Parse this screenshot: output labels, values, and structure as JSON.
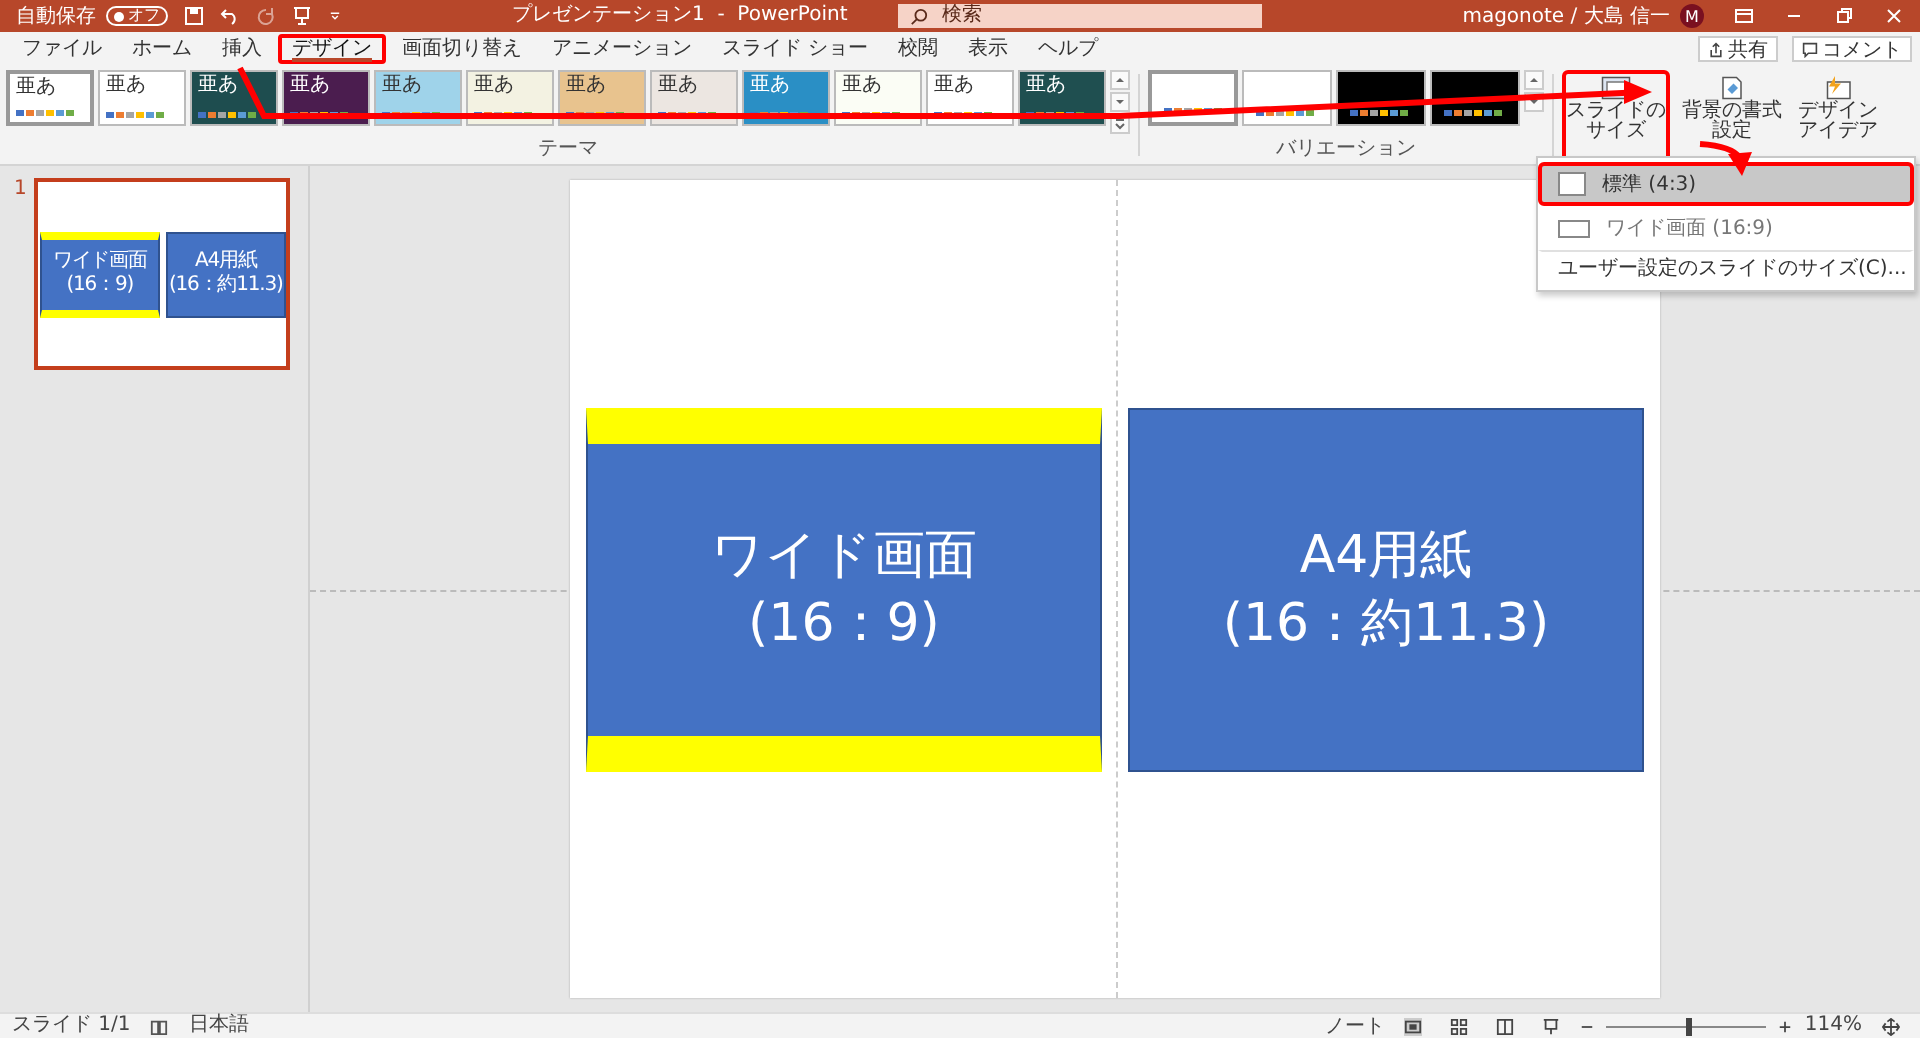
{
  "title_bar": {
    "autosave_label": "自動保存",
    "autosave_toggle": {
      "label": "オフ",
      "on": false
    },
    "title": "プレゼンテーション1  -  PowerPoint",
    "search": {
      "placeholder": "検索"
    },
    "user": "magonote / 大島 信一",
    "avatar": "M"
  },
  "tabs": [
    {
      "label": "ファイル",
      "selected": false,
      "highlighted": false
    },
    {
      "label": "ホーム",
      "selected": false,
      "highlighted": false
    },
    {
      "label": "挿入",
      "selected": false,
      "highlighted": false
    },
    {
      "label": "デザイン",
      "selected": true,
      "highlighted": true
    },
    {
      "label": "画面切り替え",
      "selected": false,
      "highlighted": false
    },
    {
      "label": "アニメーション",
      "selected": false,
      "highlighted": false
    },
    {
      "label": "スライド ショー",
      "selected": false,
      "highlighted": false
    },
    {
      "label": "校閲",
      "selected": false,
      "highlighted": false
    },
    {
      "label": "表示",
      "selected": false,
      "highlighted": false
    },
    {
      "label": "ヘルプ",
      "selected": false,
      "highlighted": false
    }
  ],
  "share_button": "共有",
  "comment_button": "コメント",
  "themes": {
    "label": "テーマ",
    "items": [
      {
        "label": "亜あ",
        "color": "#ffffff",
        "selected": true
      },
      {
        "label": "亜あ",
        "color": "#ffffff",
        "selected": false
      },
      {
        "label": "亜あ",
        "color": "#1e4d4f",
        "selected": false
      },
      {
        "label": "亜あ",
        "color": "#4b1d4f",
        "selected": false
      },
      {
        "label": "亜あ",
        "color": "#9fd3ea",
        "selected": false
      },
      {
        "label": "亜あ",
        "color": "#f3f2e2",
        "selected": false
      },
      {
        "label": "亜あ",
        "color": "#e8c38e",
        "selected": false
      },
      {
        "label": "亜あ",
        "color": "#ece6e1",
        "selected": false
      },
      {
        "label": "亜あ",
        "color": "#2a8fc5",
        "selected": false
      },
      {
        "label": "亜あ",
        "color": "#fbfdf5",
        "selected": false
      },
      {
        "label": "亜あ",
        "color": "#ffffff",
        "selected": false
      },
      {
        "label": "亜あ",
        "color": "#1f4f50",
        "selected": false
      }
    ]
  },
  "variations": {
    "label": "バリエーション",
    "items": [
      {
        "color": "#ffffff",
        "selected": true
      },
      {
        "color": "#ffffff",
        "selected": false
      },
      {
        "color": "#000000",
        "selected": false
      },
      {
        "color": "#000000",
        "selected": false
      }
    ]
  },
  "slide_size_button": {
    "label": "スライドのサイズ",
    "highlighted": true
  },
  "format_background_button": "背景の書式設定",
  "design_ideas_button": "デザインアイデア",
  "slide_size_menu": [
    {
      "label": "標準 (4:3)",
      "selected": true,
      "highlighted": true
    },
    {
      "label": "ワイド画面 (16:9)",
      "selected": false,
      "highlighted": false
    },
    {
      "label": "ユーザー設定のスライドのサイズ(C)...",
      "selected": false,
      "highlighted": false,
      "kind": "command"
    }
  ],
  "thumbnail": {
    "number": "1",
    "selected": true,
    "shapes": [
      {
        "kind": "banded",
        "lines": [
          "ワイド画面",
          "(16：9)"
        ]
      },
      {
        "kind": "plain",
        "lines": [
          "A4用紙",
          "(16：約11.3)"
        ]
      }
    ]
  },
  "slide": {
    "shapes": [
      {
        "kind": "banded",
        "lines": [
          "ワイド画面",
          "(16：9)"
        ]
      },
      {
        "kind": "plain",
        "lines": [
          "A4用紙",
          "(16：約11.3)"
        ]
      }
    ]
  },
  "status_bar": {
    "slide": "スライド 1/1",
    "language": "日本語",
    "notes": "ノート",
    "zoom": {
      "level": 0.5,
      "reading": "114%"
    }
  }
}
